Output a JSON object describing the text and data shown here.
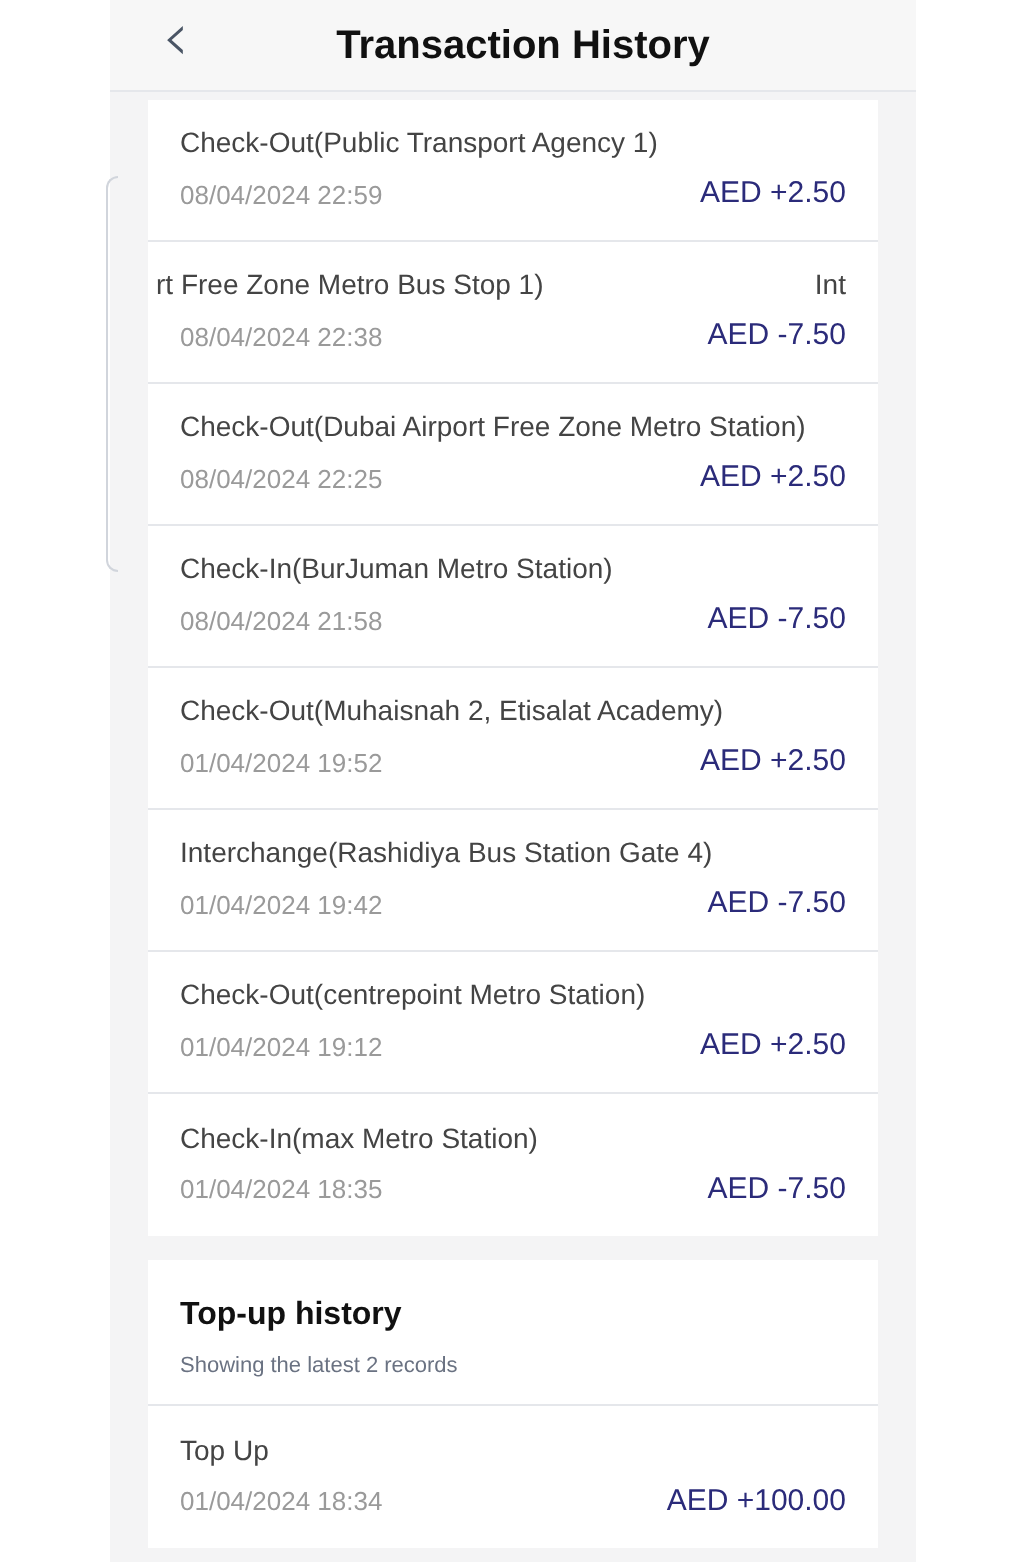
{
  "header": {
    "back_icon": "‹",
    "title": "Transaction History"
  },
  "transactions": [
    {
      "kind": "normal",
      "title": "Check-Out(Public Transport Agency 1)",
      "date": "08/04/2024 22:59",
      "amount": "AED +2.50"
    },
    {
      "kind": "scrolled",
      "title": "rt Free Zone Metro Bus Stop 1)",
      "side_text": "Int",
      "date": "08/04/2024 22:38",
      "amount": "AED -7.50"
    },
    {
      "kind": "normal",
      "title": "Check-Out(Dubai Airport Free Zone Metro Station)",
      "date": "08/04/2024 22:25",
      "amount": "AED +2.50"
    },
    {
      "kind": "normal",
      "title": "Check-In(BurJuman Metro Station)",
      "date": "08/04/2024 21:58",
      "amount": "AED -7.50"
    },
    {
      "kind": "normal",
      "title": "Check-Out(Muhaisnah 2, Etisalat Academy)",
      "date": "01/04/2024 19:52",
      "amount": "AED +2.50"
    },
    {
      "kind": "normal",
      "title": "Interchange(Rashidiya Bus Station Gate 4)",
      "date": "01/04/2024 19:42",
      "amount": "AED -7.50"
    },
    {
      "kind": "normal",
      "title": "Check-Out(centrepoint Metro Station)",
      "date": "01/04/2024 19:12",
      "amount": "AED +2.50"
    },
    {
      "kind": "normal",
      "title": "Check-In(max Metro Station)",
      "date": "01/04/2024 18:35",
      "amount": "AED -7.50"
    }
  ],
  "topup": {
    "title": "Top-up history",
    "subtitle": "Showing the latest 2 records",
    "rows": [
      {
        "title": "Top Up",
        "date": "01/04/2024 18:34",
        "amount": "AED +100.00"
      }
    ]
  }
}
